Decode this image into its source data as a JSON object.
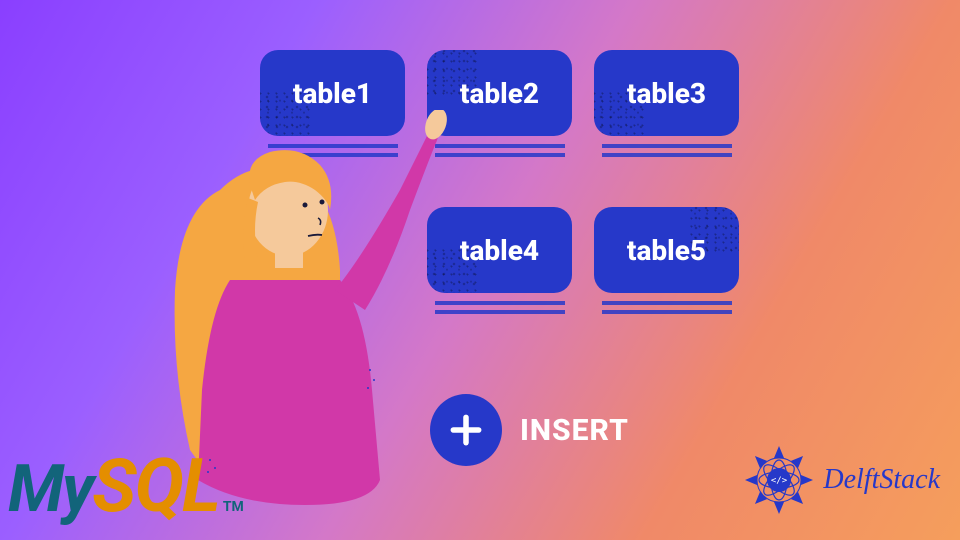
{
  "tables": {
    "row1": [
      {
        "label": "table1"
      },
      {
        "label": "table2"
      },
      {
        "label": "table3"
      }
    ],
    "row2": [
      {
        "label": "table4"
      },
      {
        "label": "table5"
      }
    ]
  },
  "insert_label": "INSERT",
  "logos": {
    "mysql_my": "My",
    "mysql_sql": "SQL",
    "mysql_tm": "TM",
    "delftstack": "DelftStack"
  }
}
